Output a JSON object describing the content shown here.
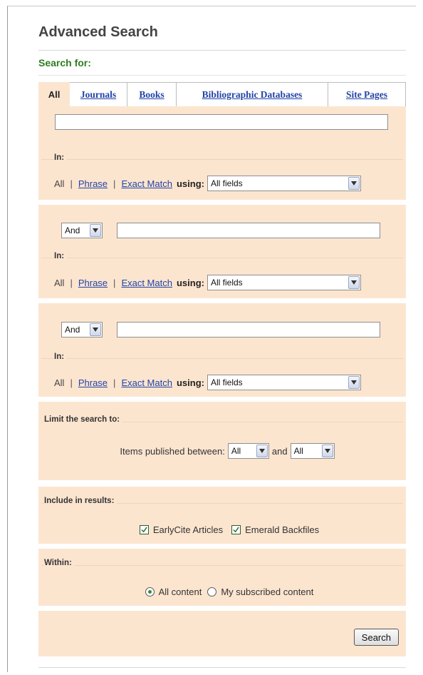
{
  "page": {
    "title": "Advanced Search",
    "search_for_label": "Search for:"
  },
  "tabs": [
    {
      "label": "All",
      "active": true
    },
    {
      "label": "Journals",
      "active": false
    },
    {
      "label": "Books",
      "active": false
    },
    {
      "label": "Bibliographic Databases",
      "active": false
    },
    {
      "label": "Site Pages",
      "active": false
    }
  ],
  "query_rows": [
    {
      "connector": "",
      "query_value": "",
      "in_label": "In:",
      "mode_all": "All",
      "mode_phrase": "Phrase",
      "mode_exact": "Exact Match",
      "using_label": "using:",
      "field": "All fields"
    },
    {
      "connector": "And",
      "query_value": "",
      "in_label": "In:",
      "mode_all": "All",
      "mode_phrase": "Phrase",
      "mode_exact": "Exact Match",
      "using_label": "using:",
      "field": "All fields"
    },
    {
      "connector": "And",
      "query_value": "",
      "in_label": "In:",
      "mode_all": "All",
      "mode_phrase": "Phrase",
      "mode_exact": "Exact Match",
      "using_label": "using:",
      "field": "All fields"
    }
  ],
  "separator": "|",
  "limit": {
    "label": "Limit the search to:",
    "published_label": "Items published between:",
    "from_value": "All",
    "and_label": "and",
    "to_value": "All"
  },
  "include": {
    "label": "Include in results:",
    "options": [
      {
        "label": "EarlyCite Articles",
        "checked": true
      },
      {
        "label": "Emerald Backfiles",
        "checked": true
      }
    ]
  },
  "within": {
    "label": "Within:",
    "options": [
      {
        "label": "All content",
        "selected": true
      },
      {
        "label": "My subscribed content",
        "selected": false
      }
    ]
  },
  "actions": {
    "search_label": "Search"
  },
  "colors": {
    "panel_bg": "#fce5cf",
    "link": "#2344a8",
    "heading_green": "#2e7d1f"
  },
  "icons": {
    "dropdown": "chevron-down-icon",
    "checkbox": "checkmark-icon",
    "radio": "radio-dot-icon"
  }
}
